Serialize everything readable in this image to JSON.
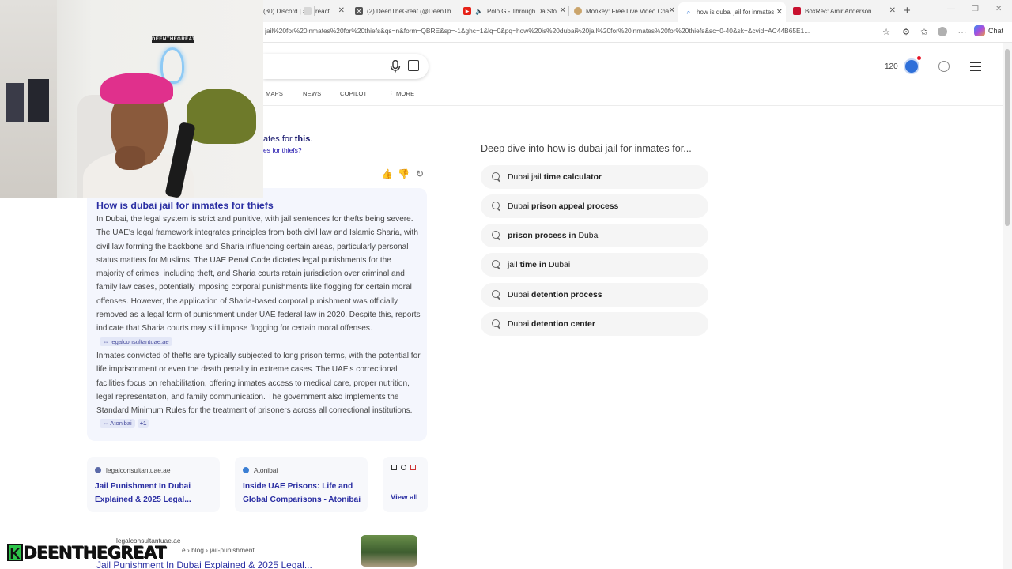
{
  "browser": {
    "tabs": [
      {
        "title": "(30) Discord | #",
        "icon": "discord-icon",
        "active": false
      },
      {
        "title": "reacti",
        "icon": "tab-icon",
        "active": false
      },
      {
        "title": "(2) DeenTheGreat (@DeenTh",
        "icon": "x-icon",
        "active": false
      },
      {
        "title": "Polo G - Through Da Sto",
        "icon": "youtube-icon",
        "active": false
      },
      {
        "title": "Monkey: Free Live Video Cha",
        "icon": "monkey-icon",
        "active": false
      },
      {
        "title": "how is dubai jail for inmates",
        "icon": "bing-icon",
        "active": true
      },
      {
        "title": "BoxRec: Amir Anderson",
        "icon": "boxrec-icon",
        "active": false
      }
    ],
    "url": "jail%20for%20inmates%20for%20thiefs&qs=n&form=QBRE&sp=-1&ghc=1&lq=0&pq=how%20is%20dubai%20jail%20for%20inmates%20for%20thiefs&sc=0-40&sk=&cvid=AC44B65E1...",
    "chat_label": "Chat"
  },
  "header": {
    "scopes": [
      "MAPS",
      "NEWS",
      "COPILOT",
      "MORE"
    ],
    "rewards_points": "120"
  },
  "snippets": {
    "fragment_1_pre": "ates for ",
    "fragment_1_bold": "this",
    "fragment_1_post": ".",
    "fragment_2": "es for thiefs?"
  },
  "answer": {
    "title": "How is dubai jail for inmates for thiefs",
    "paragraph_1": "In Dubai, the legal system is strict and punitive, with jail sentences for thefts being severe. The UAE's legal framework integrates principles from both civil law and Islamic Sharia, with civil law forming the backbone and Sharia influencing certain areas, particularly personal status matters for Muslims. The UAE Penal Code dictates legal punishments for the majority of crimes, including theft, and Sharia courts retain jurisdiction over criminal and family law cases, potentially imposing corporal punishments like flogging for certain moral offenses. However, the application of Sharia-based corporal punishment was officially removed as a legal form of punishment under UAE federal law in 2020. Despite this, reports indicate that Sharia courts may still impose flogging for certain moral offenses.",
    "citation_1": "legalconsultantuae.ae",
    "paragraph_2": "Inmates convicted of thefts are typically subjected to long prison terms, with the potential for life imprisonment or even the death penalty in extreme cases. The UAE's correctional facilities focus on rehabilitation, offering inmates access to medical care, proper nutrition, legal representation, and family communication. The government also implements the Standard Minimum Rules for the treatment of prisoners across all correctional institutions.",
    "citation_2": "Atonibai",
    "citation_2_more": "+1"
  },
  "sources": [
    {
      "site": "legalconsultantuae.ae",
      "title": "Jail Punishment In Dubai Explained & 2025 Legal...",
      "color": "#5b6aa8"
    },
    {
      "site": "Atonibai",
      "title": "Inside UAE Prisons: Life and Global Comparisons - Atonibai",
      "color": "#3b7fd4"
    }
  ],
  "view_all_label": "View all",
  "bottom_result": {
    "site": "legalconsultantuae.ae",
    "path": "e › blog › jail-punishment...",
    "title": "Jail Punishment In Dubai Explained & 2025 Legal..."
  },
  "related": {
    "heading": "Deep dive into how is dubai jail for inmates for...",
    "items": [
      {
        "pre": "Dubai jail ",
        "bold": "time calculator",
        "post": ""
      },
      {
        "pre": "Dubai ",
        "bold": "prison appeal process",
        "post": ""
      },
      {
        "pre": "",
        "bold": "prison process in",
        "post": " Dubai"
      },
      {
        "pre": "jail ",
        "bold": "time in",
        "post": " Dubai"
      },
      {
        "pre": "Dubai ",
        "bold": "detention process",
        "post": ""
      },
      {
        "pre": "Dubai ",
        "bold": "detention center",
        "post": ""
      }
    ]
  },
  "webcam": {
    "sign_text": "DEENTHEGREAT"
  },
  "watermark": {
    "k": "K",
    "name": "DEENTHEGREAT"
  }
}
